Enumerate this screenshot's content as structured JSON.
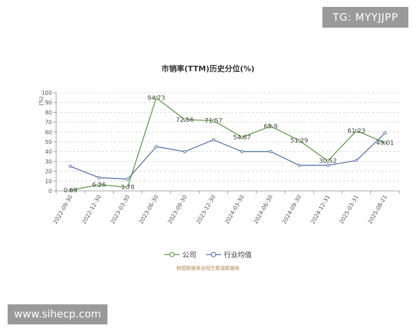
{
  "badges": {
    "top_right": "TG: MYYJJPP",
    "bottom_left": "www.sihecp.com"
  },
  "source_note": "制图数据来自恒生聚源数据库",
  "chart_data": {
    "type": "line",
    "title": "市销率(TTM)历史分位(%)",
    "ylabel": "(%)",
    "xlabel": "",
    "ylim": [
      0,
      100
    ],
    "yticks": [
      0,
      10,
      20,
      30,
      40,
      50,
      60,
      70,
      80,
      90,
      100
    ],
    "grid": true,
    "legend_position": "bottom",
    "x_tick_labels": [
      "2022-09-30",
      "2022-12-30",
      "2023-03-30",
      "2023-06-30",
      "2023-09-30",
      "2023-12-30",
      "2024-03-30",
      "2024-06-30",
      "2024-09-30",
      "2024-12-31",
      "2025-03-31",
      "2025-08-21"
    ],
    "series": [
      {
        "name": "公司",
        "color": "#5a9a46",
        "values": [
          0.69,
          6.26,
          3.78,
          94.73,
          72.56,
          71.57,
          54.67,
          65.9,
          51.29,
          30.52,
          61.23,
          49.01
        ],
        "labels": [
          "0.69",
          "6.26",
          "3.78",
          "94.73",
          "72.56",
          "71.57",
          "54.67",
          "65.9",
          "51.29",
          "30.52",
          "61.23",
          "49.01"
        ]
      },
      {
        "name": "行业均值",
        "color": "#5470a8",
        "values": [
          25,
          13.5,
          12,
          45,
          40,
          52,
          40,
          40,
          26,
          26,
          31,
          59
        ]
      }
    ]
  }
}
